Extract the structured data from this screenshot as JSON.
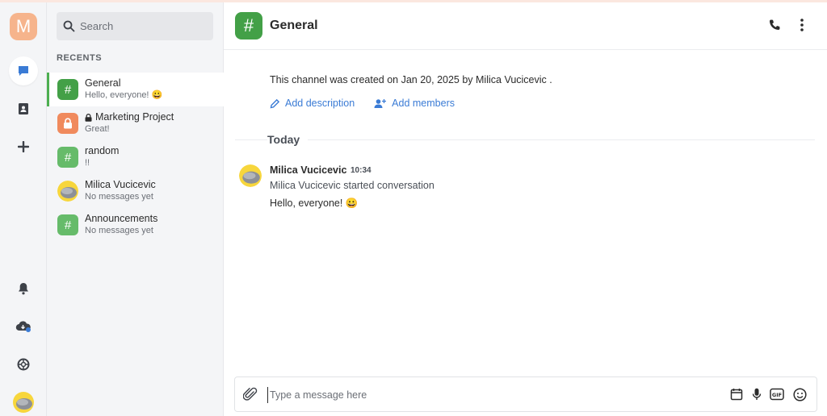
{
  "rail": {
    "workspace_initial": "M"
  },
  "search": {
    "placeholder": "Search"
  },
  "recents_label": "RECENTS",
  "channels": [
    {
      "name": "General",
      "preview": "Hello, everyone! 😀",
      "type": "channel",
      "color": "#43a047"
    },
    {
      "name": "Marketing Project",
      "preview": "Great!",
      "type": "private",
      "color": "#f08a5d"
    },
    {
      "name": "random",
      "preview": "!!",
      "type": "channel",
      "color": "#66bb6a"
    },
    {
      "name": "Milica Vucicevic",
      "preview": "No messages yet",
      "type": "dm"
    },
    {
      "name": "Announcements",
      "preview": "No messages yet",
      "type": "channel",
      "color": "#66bb6a"
    }
  ],
  "header": {
    "title": "General"
  },
  "intro": {
    "created_text": "This channel was created on Jan 20, 2025 by Milica Vucicevic .",
    "add_description": "Add description",
    "add_members": "Add members"
  },
  "day_label": "Today",
  "message": {
    "author": "Milica Vucicevic",
    "time": "10:34",
    "system_text": "Milica Vucicevic started conversation",
    "body": "Hello, everyone! 😀"
  },
  "composer": {
    "placeholder": "Type a message here"
  },
  "colors": {
    "accent": "#3a7bd5",
    "active_border": "#4caf50"
  }
}
